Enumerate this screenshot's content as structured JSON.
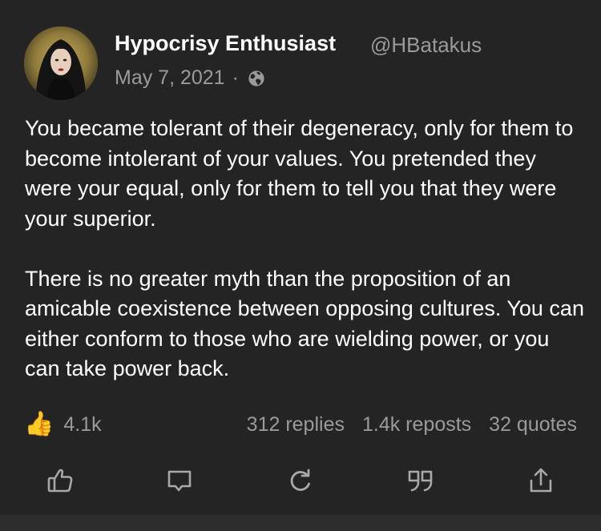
{
  "author": {
    "name": "Hypocrisy Enthusiast",
    "handle": "@HBatakus",
    "date": "May 7, 2021",
    "separator": "·",
    "visibility_icon": "globe-icon"
  },
  "post": {
    "paragraphs": [
      "You became tolerant of their degeneracy, only for them to become intolerant of your values. You pretended they were your equal, only for them to tell you that they were your superior.",
      "There is no greater myth than the proposition of an amicable coexistence between opposing cultures. You can either conform to those who are wielding power, or you can take power back."
    ]
  },
  "stats": {
    "reaction_emoji": "👍",
    "likes": "4.1k",
    "replies": "312 replies",
    "reposts": "1.4k reposts",
    "quotes": "32 quotes"
  },
  "actions": [
    {
      "name": "like",
      "icon": "thumbs-up-icon"
    },
    {
      "name": "reply",
      "icon": "comment-icon"
    },
    {
      "name": "repost",
      "icon": "repost-icon"
    },
    {
      "name": "quote",
      "icon": "quote-icon"
    },
    {
      "name": "share",
      "icon": "share-icon"
    }
  ],
  "colors": {
    "background": "#242424",
    "text": "#ffffff",
    "muted": "#9a9a9a",
    "icon": "#a8a8a8"
  }
}
